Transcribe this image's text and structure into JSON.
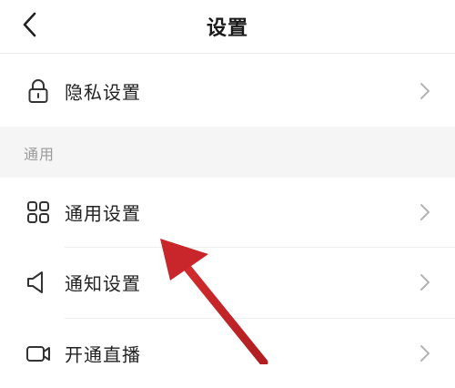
{
  "header": {
    "title": "设置",
    "back_icon": "chevron-left-icon"
  },
  "privacy_row": {
    "label": "隐私设置",
    "icon": "lock-icon"
  },
  "general_section": {
    "label": "通用"
  },
  "rows": [
    {
      "label": "通用设置",
      "icon": "grid-apps-icon"
    },
    {
      "label": "通知设置",
      "icon": "speaker-icon"
    },
    {
      "label": "开通直播",
      "icon": "video-camera-icon"
    }
  ],
  "colors": {
    "background": "#ffffff",
    "section_background": "#f5f5f5",
    "text": "#222222",
    "muted": "#9a9a9a",
    "chevron": "#b3b3b3",
    "annotation_arrow": "#c8262a"
  }
}
